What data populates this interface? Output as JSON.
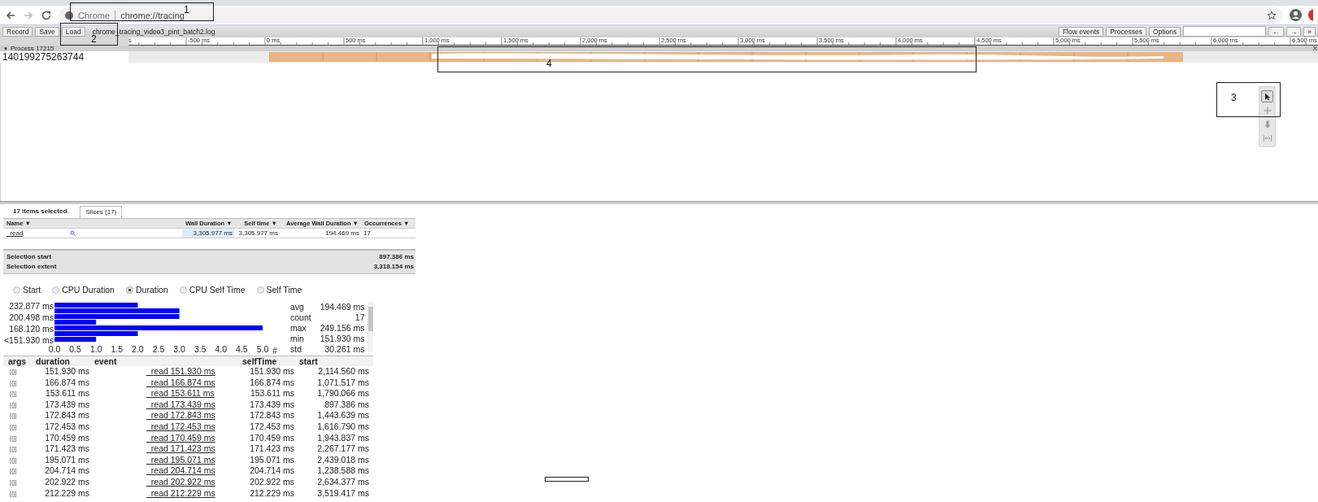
{
  "browser": {
    "origin": "Chrome",
    "url": "chrome://tracing"
  },
  "toolbar": {
    "buttons_left": [
      "Record",
      "Save",
      "Load"
    ],
    "filename": "chrome_tracing_video3_pint_batch2.log",
    "buttons_right": [
      "Flow events",
      "Processes",
      "Options"
    ],
    "nav_buttons": [
      "←",
      "→",
      "»"
    ]
  },
  "ruler": {
    "ticks": [
      "s",
      "-500 ms",
      "0 ms",
      "500 ms",
      "1,000 ms",
      "1,500 ms",
      "2,000 ms",
      "2,500 ms",
      "3,000 ms",
      "3,500 ms",
      "4,000 ms",
      "4,500 ms",
      "5,000 ms",
      "5,500 ms",
      "6,000 ms",
      "6,500 ms"
    ]
  },
  "process": {
    "toggle": "▼",
    "title": "Process 17215",
    "close": "X",
    "threads": [
      {
        "name": "140199275263744"
      }
    ]
  },
  "tool_palette": [
    {
      "kind": "select",
      "selected": true
    },
    {
      "kind": "pan",
      "selected": false
    },
    {
      "kind": "zoom",
      "selected": false
    },
    {
      "kind": "timing",
      "selected": false
    }
  ],
  "analysis": {
    "summary": "17 items selected.",
    "tabs": [
      {
        "label": "Slices (17)",
        "selected": true
      }
    ],
    "columns": [
      {
        "label": "Name",
        "sort": "▼"
      },
      {
        "label": "Wall Duration",
        "sort": "▼"
      },
      {
        "label": "Self time",
        "sort": "▼"
      },
      {
        "label": "Average Wall Duration",
        "sort": "▼"
      },
      {
        "label": "Occurrences",
        "sort": "▼"
      }
    ],
    "rows": [
      {
        "name": "_read",
        "wall_duration": "3,305.977 ms",
        "self_time": "3,305.977 ms",
        "average_wall_duration": "194.469 ms",
        "occurrences": "17"
      }
    ],
    "selection": [
      {
        "label": "Selection start",
        "value": "897.386 ms"
      },
      {
        "label": "Selection extent",
        "value": "3,318.154 ms"
      }
    ],
    "metrics": [
      {
        "label": "Start",
        "selected": false
      },
      {
        "label": "CPU Duration",
        "selected": false
      },
      {
        "label": "Duration",
        "selected": true
      },
      {
        "label": "CPU Self Time",
        "selected": false
      },
      {
        "label": "Self Time",
        "selected": false
      }
    ],
    "histogram": {
      "chart_data": {
        "type": "bar",
        "orientation": "horizontal",
        "xlabel": "#",
        "values": [
          2,
          3,
          3,
          1,
          5,
          2,
          1
        ],
        "xlim": [
          0,
          5
        ],
        "categories": [
          "232.877 ms",
          null,
          "200.498 ms",
          null,
          "168.120 ms",
          null,
          "<151.930 ms"
        ],
        "xticks": [
          {
            "value": 0,
            "label": "0.0"
          },
          {
            "value": 0.5,
            "label": "0.5"
          },
          {
            "value": 1,
            "label": "1.0"
          },
          {
            "value": 1.5,
            "label": "1.5"
          },
          {
            "value": 2,
            "label": "2.0"
          },
          {
            "value": 2.5,
            "label": "2.5"
          },
          {
            "value": 3,
            "label": "3.0"
          },
          {
            "value": 3.5,
            "label": "3.5"
          },
          {
            "value": 4,
            "label": "4.0"
          },
          {
            "value": 4.5,
            "label": "4.5"
          },
          {
            "value": 5,
            "label": "5.0"
          }
        ]
      }
    },
    "stats": [
      {
        "label": "avg",
        "value": "194.469 ms"
      },
      {
        "label": "count",
        "value": "17"
      },
      {
        "label": "max",
        "value": "249.156 ms"
      },
      {
        "label": "min",
        "value": "151.930 ms"
      },
      {
        "label": "std",
        "value": "30.261 ms"
      }
    ],
    "events": {
      "columns": [
        "args",
        "duration",
        "event",
        "selfTime",
        "start"
      ],
      "rows": [
        {
          "args": "[{}]",
          "duration": "151.930 ms",
          "event": "_read 151.930 ms",
          "self_time": "151.930 ms",
          "start": "2,114.560 ms"
        },
        {
          "args": "[{}]",
          "duration": "166.874 ms",
          "event": "_read 166.874 ms",
          "self_time": "166.874 ms",
          "start": "1,071.517 ms"
        },
        {
          "args": "[{}]",
          "duration": "153.611 ms",
          "event": "_read 153.611 ms",
          "self_time": "153.611 ms",
          "start": "1,790.066 ms"
        },
        {
          "args": "[{}]",
          "duration": "173.439 ms",
          "event": "_read 173.439 ms",
          "self_time": "173.439 ms",
          "start": "897.386 ms"
        },
        {
          "args": "[{}]",
          "duration": "172.843 ms",
          "event": "_read 172.843 ms",
          "self_time": "172.843 ms",
          "start": "1,443.639 ms"
        },
        {
          "args": "[{}]",
          "duration": "172.453 ms",
          "event": "_read 172.453 ms",
          "self_time": "172.453 ms",
          "start": "1,616.790 ms"
        },
        {
          "args": "[{}]",
          "duration": "170.459 ms",
          "event": "_read 170.459 ms",
          "self_time": "170.459 ms",
          "start": "1,943.837 ms"
        },
        {
          "args": "[{}]",
          "duration": "171.423 ms",
          "event": "_read 171.423 ms",
          "self_time": "171.423 ms",
          "start": "2,267.177 ms"
        },
        {
          "args": "[{}]",
          "duration": "195.071 ms",
          "event": "_read 195.071 ms",
          "self_time": "195.071 ms",
          "start": "2,439.018 ms"
        },
        {
          "args": "[{}]",
          "duration": "204.714 ms",
          "event": "_read 204.714 ms",
          "self_time": "204.714 ms",
          "start": "1,238.588 ms"
        },
        {
          "args": "[{}]",
          "duration": "202.922 ms",
          "event": "_read 202.922 ms",
          "self_time": "202.922 ms",
          "start": "2,634.377 ms"
        },
        {
          "args": "[{}]",
          "duration": "212.229 ms",
          "event": "_read 212.229 ms",
          "self_time": "212.229 ms",
          "start": "3,519.417 ms"
        }
      ]
    }
  },
  "annotations": [
    {
      "label": "1"
    },
    {
      "label": "2"
    },
    {
      "label": "3"
    },
    {
      "label": "4"
    }
  ]
}
